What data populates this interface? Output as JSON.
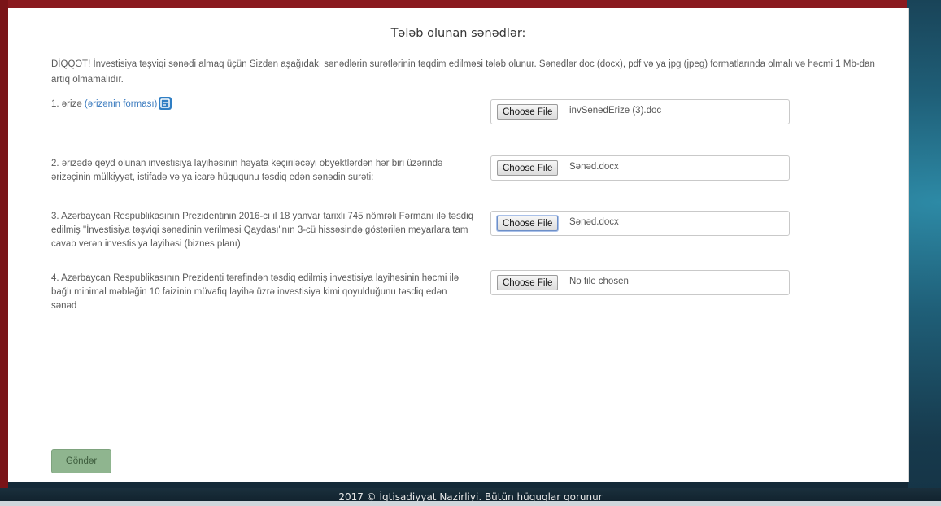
{
  "page": {
    "title": "Tələb olunan sənədlər:",
    "notice": "DİQQƏT! İnvestisiya təşviqi sənədi almaq üçün Sizdən aşağıdakı sənədlərin surətlərinin təqdim edilməsi tələb olunur. Sənədlər doc (docx), pdf və ya jpg (jpeg) formatlarında olmalı və həcmi 1 Mb-dan artıq olmamalıdır."
  },
  "documents": [
    {
      "label": "1. ərizə",
      "link": "(ərizənin forması)",
      "button": "Choose File",
      "file": "invSenedErize (3).doc"
    },
    {
      "label": "2. ərizədə qeyd olunan investisiya layihəsinin həyata keçiriləcəyi obyektlərdən hər biri üzərində ərizəçinin mülkiyyət, istifadə və ya icarə hüququnu təsdiq edən sənədin surəti:",
      "button": "Choose File",
      "file": "Sənəd.docx"
    },
    {
      "label": "3. Azərbaycan Respublikasının Prezidentinin 2016-cı il 18 yanvar tarixli 745 nömrəli Fərmanı ilə təsdiq edilmiş \"İnvestisiya təşviqi sənədinin verilməsi Qaydası\"nın 3-cü hissəsində göstərilən meyarlara tam cavab verən investisiya layihəsi (biznes planı)",
      "button": "Choose File",
      "file": "Sənəd.docx"
    },
    {
      "label": "4. Azərbaycan Respublikasının Prezidenti tərəfindən təsdiq edilmiş investisiya layihəsinin həcmi ilə bağlı minimal məbləğin 10 faizinin müvafiq layihə üzrə investisiya kimi qoyulduğunu təsdiq edən sənəd",
      "button": "Choose File",
      "file": "No file chosen"
    }
  ],
  "actions": {
    "submit": "Göndər"
  },
  "footer": {
    "text": "2017 © İqtisadiyyat Nazirliyi. Bütün hüquqlar qorunur"
  },
  "icons": {
    "form_download": "document-icon"
  },
  "colors": {
    "accent_link": "#3b7bbf",
    "submit_bg": "#8fb58f",
    "frame_red": "#8a1a1f"
  }
}
